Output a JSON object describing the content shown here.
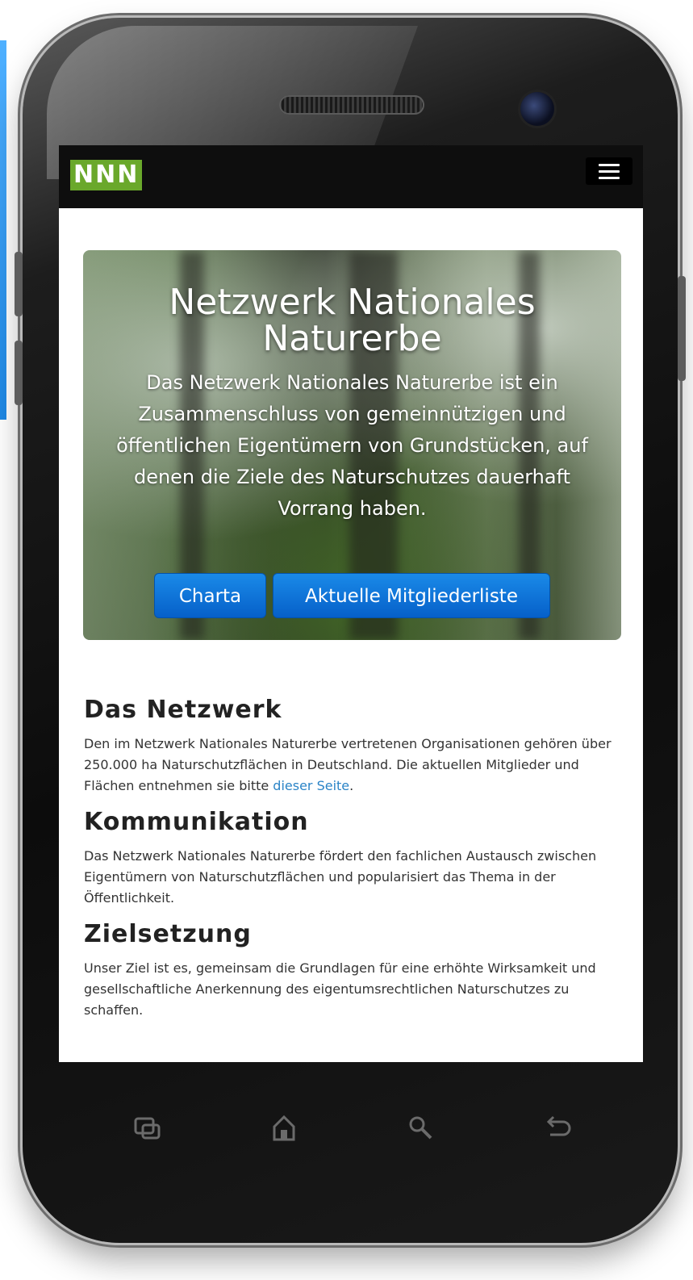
{
  "navbar": {
    "brand": "NNN"
  },
  "hero": {
    "title_line1": "Netzwerk Nationales",
    "title_line2": "Naturerbe",
    "text": "Das Netzwerk Nationales Naturerbe ist ein Zusammenschluss von gemeinnützigen und öffentlichen Eigentümern von Grundstücken, auf denen die Ziele des Naturschutzes dauerhaft Vorrang haben.",
    "buttons": {
      "charta": "Charta",
      "members": "Aktuelle Mitgliederliste"
    }
  },
  "sections": {
    "netzwerk": {
      "heading": "Das Netzwerk",
      "text_before_link": "Den im Netzwerk Nationales Naturerbe vertretenen Organisationen gehören über 250.000 ha Naturschutzflächen in Deutschland. Die aktuellen Mitglieder und Flächen entnehmen sie bitte ",
      "link": "dieser Seite",
      "text_after_link": "."
    },
    "kommunikation": {
      "heading": "Kommunikation",
      "text": "Das Netzwerk Nationales Naturerbe fördert den fachlichen Austausch zwischen Eigentümern von Naturschutzflächen und popularisiert das Thema in der Öffentlichkeit."
    },
    "zielsetzung": {
      "heading": "Zielsetzung",
      "text": "Unser Ziel ist es, gemeinsam die Grundlagen für eine erhöhte Wirksamkeit und gesellschaftliche Anerkennung des eigentumsrechtlichen Naturschutzes zu schaffen."
    }
  },
  "softkeys": {
    "recent": "recent-apps-icon",
    "home": "home-icon",
    "search": "search-icon",
    "back": "back-icon"
  },
  "colors": {
    "brand_bg": "#6aa82b",
    "navbar_bg": "#0e0e0e",
    "button_bg": "#0b70d8",
    "link": "#2b84c7"
  }
}
